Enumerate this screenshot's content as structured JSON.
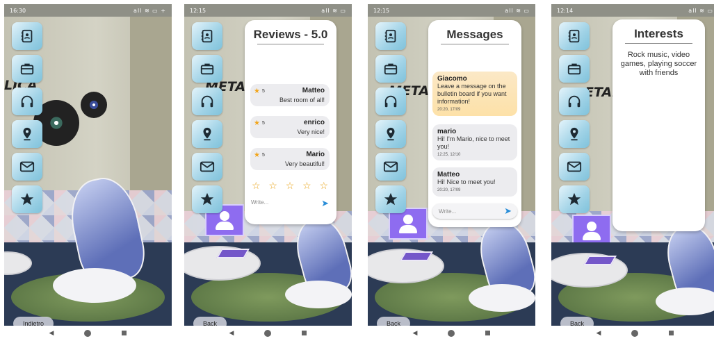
{
  "screens": [
    {
      "status_time": "16:30",
      "status_right": "all ≋ ▭ +",
      "back_label": "Indietro",
      "scene_sign": "LICA"
    },
    {
      "status_time": "12:15",
      "status_right": "all ≋ ▭",
      "back_label": "Back",
      "scene_sign": "METAL",
      "panel": {
        "title": "Reviews - 5.0",
        "reviews": [
          {
            "rating": "5",
            "author": "Matteo",
            "text": "Best room of all!"
          },
          {
            "rating": "5",
            "author": "enrico",
            "text": "Very nice!"
          },
          {
            "rating": "5",
            "author": "Mario",
            "text": "Very beautiful!"
          }
        ],
        "empty_stars": "☆",
        "write_placeholder": "Write..."
      }
    },
    {
      "status_time": "12:15",
      "status_right": "all ≋ ▭",
      "back_label": "Back",
      "scene_sign": "METAL",
      "panel": {
        "title": "Messages",
        "messages": [
          {
            "author": "Giacomo",
            "text": "Leave a message on the bulletin board if you want information!",
            "time": "20:20, 17/09"
          },
          {
            "author": "mario",
            "text": "Hi! I'm Mario, nice to meet you!",
            "time": "12:25, 12/10"
          },
          {
            "author": "Matteo",
            "text": "Hi! Nice to meet you!",
            "time": "20:20, 17/09"
          }
        ],
        "write_placeholder": "Write..."
      }
    },
    {
      "status_time": "12:14",
      "status_right": "all ≋ ▭",
      "back_label": "Back",
      "scene_sign": "ETAL",
      "panel": {
        "title": "Interests",
        "text": "Rock music, video games, playing soccer with friends"
      }
    }
  ],
  "menu_icons": [
    "contacts-book-icon",
    "briefcase-icon",
    "headphones-icon",
    "location-pin-icon",
    "mail-icon",
    "star-icon"
  ],
  "nav": {
    "back": "◀",
    "home": "●",
    "recents": "■"
  },
  "colors": {
    "accent_blue": "#2a8ed8",
    "star_orange": "#f2a51a",
    "menu_tile": "#9fd2e6",
    "highlight_msg": "#fde1a8"
  }
}
